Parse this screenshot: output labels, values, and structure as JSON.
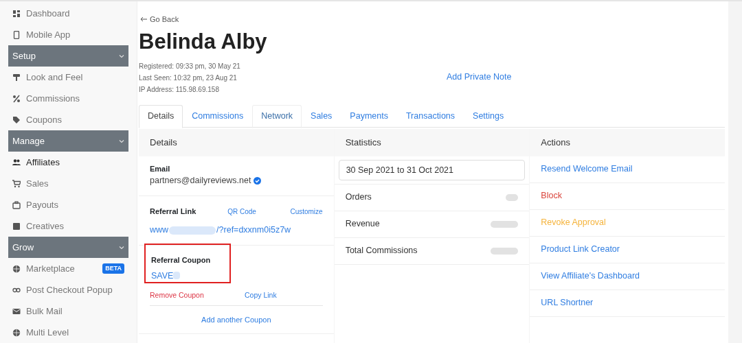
{
  "sidebar": {
    "items": [
      {
        "kind": "link",
        "label": "Dashboard",
        "selected": false
      },
      {
        "kind": "link",
        "label": "Mobile App",
        "selected": false
      },
      {
        "kind": "section",
        "label": "Setup",
        "expanded": true
      },
      {
        "kind": "link",
        "label": "Look and Feel",
        "selected": false
      },
      {
        "kind": "link",
        "label": "Commissions",
        "selected": false
      },
      {
        "kind": "link",
        "label": "Coupons",
        "selected": false
      },
      {
        "kind": "section",
        "label": "Manage",
        "expanded": true
      },
      {
        "kind": "link",
        "label": "Affiliates",
        "selected": true
      },
      {
        "kind": "link",
        "label": "Sales",
        "selected": false
      },
      {
        "kind": "link",
        "label": "Payouts",
        "selected": false
      },
      {
        "kind": "link",
        "label": "Creatives",
        "selected": false
      },
      {
        "kind": "section",
        "label": "Grow",
        "expanded": true
      },
      {
        "kind": "link",
        "label": "Marketplace",
        "selected": false,
        "badge": "BETA"
      },
      {
        "kind": "link",
        "label": "Post Checkout Popup",
        "selected": false
      },
      {
        "kind": "link",
        "label": "Bulk Mail",
        "selected": false
      },
      {
        "kind": "link",
        "label": "Multi Level",
        "selected": false
      }
    ]
  },
  "back_link": "Go Back",
  "title": "Belinda Alby",
  "meta": [
    "Registered: 09:33 pm, 30 May 21",
    "Last Seen: 10:32 pm, 23 Aug 21",
    "IP Address: 115.98.69.158"
  ],
  "private_note_link": "Add Private Note",
  "tabs": [
    {
      "label": "Details",
      "selected": true,
      "outlined": false
    },
    {
      "label": "Commissions",
      "selected": false,
      "outlined": false
    },
    {
      "label": "Network",
      "selected": false,
      "outlined": true
    },
    {
      "label": "Sales",
      "selected": false,
      "outlined": false
    },
    {
      "label": "Payments",
      "selected": false,
      "outlined": false
    },
    {
      "label": "Transactions",
      "selected": false,
      "outlined": false
    },
    {
      "label": "Settings",
      "selected": false,
      "outlined": false
    }
  ],
  "details": {
    "title": "Details",
    "email": {
      "label": "Email",
      "value": "partners@dailyreviews.net",
      "verified": true
    },
    "referral_link": {
      "label": "Referral Link",
      "qr_link": "QR Code",
      "customize_link": "Customize",
      "url_start": "www",
      "url_end": "/?ref=dxxnm0i5z7w"
    },
    "referral_coupon": {
      "label": "Referral Coupon",
      "code": "SAVE",
      "highlighted": true,
      "remove_link": "Remove Coupon",
      "copy_link": "Copy Link",
      "add_link": "Add another Coupon"
    }
  },
  "statistics": {
    "title": "Statistics",
    "date_range": "30 Sep 2021 to 31 Oct 2021",
    "rows": [
      {
        "label": "Orders"
      },
      {
        "label": "Revenue"
      },
      {
        "label": "Total Commissions"
      }
    ]
  },
  "actions": {
    "title": "Actions",
    "items": [
      {
        "label": "Resend Welcome Email",
        "kind": "link"
      },
      {
        "label": "Block",
        "kind": "danger"
      },
      {
        "label": "Revoke Approval",
        "kind": "warning"
      },
      {
        "label": "Product Link Creator",
        "kind": "link"
      },
      {
        "label": "View Affiliate's Dashboard",
        "kind": "link"
      },
      {
        "label": "URL Shortner",
        "kind": "link"
      }
    ]
  }
}
